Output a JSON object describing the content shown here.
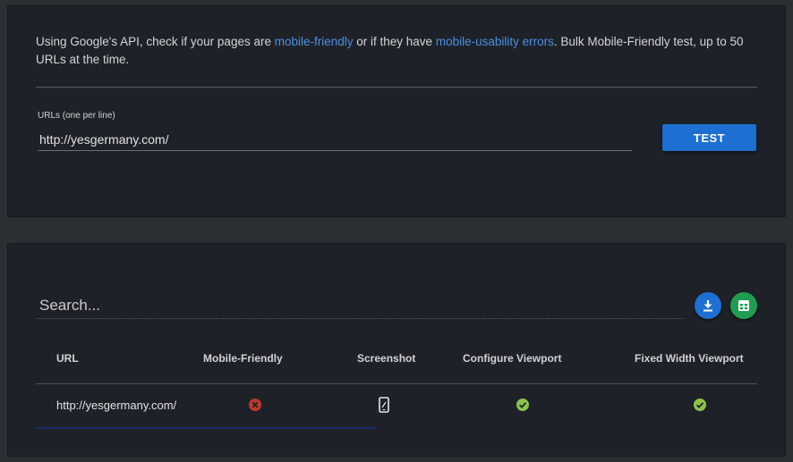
{
  "intro": {
    "prefix": "Using Google's API, check if your pages are ",
    "link1": "mobile-friendly",
    "middle": " or if they have ",
    "link2": "mobile-usability errors",
    "suffix": ". Bulk Mobile-Friendly test, up to 50 URLs at the time."
  },
  "form": {
    "url_label": "URLs (one per line)",
    "url_value": "http://yesgermany.com/",
    "test_label": "TEST"
  },
  "results": {
    "search_placeholder": "Search...",
    "download_icon": "download-icon",
    "sheets_icon": "google-sheets-icon",
    "columns": [
      "URL",
      "Mobile-Friendly",
      "Screenshot",
      "Configure Viewport",
      "Fixed Width Viewport"
    ],
    "rows": [
      {
        "url": "http://yesgermany.com/",
        "mobile_friendly": "fail",
        "screenshot": "phone-icon",
        "configure_viewport": "pass",
        "fixed_width_viewport": "pass"
      }
    ]
  },
  "colors": {
    "accent": "#1d6fd2",
    "link": "#4a8fe0",
    "sheets": "#1f9d52",
    "pass": "#8bc34a",
    "fail": "#c0392b"
  }
}
